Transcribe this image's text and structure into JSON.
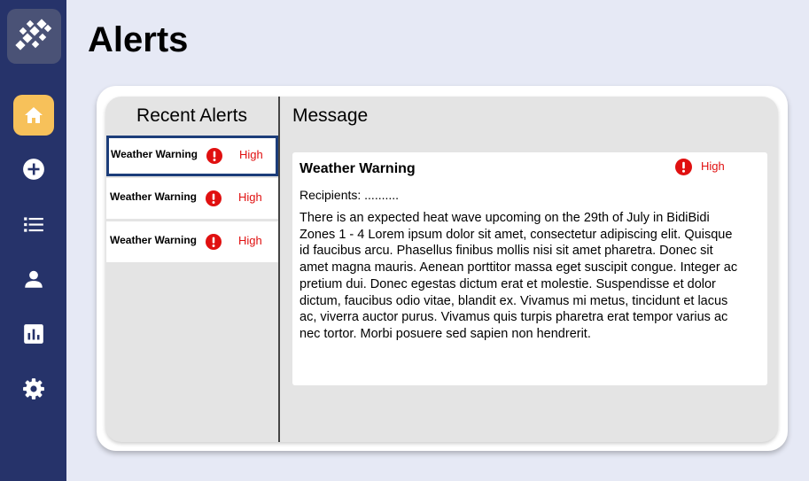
{
  "page": {
    "title": "Alerts"
  },
  "sidebar": {
    "nav": [
      {
        "icon": "home-icon",
        "active": true
      },
      {
        "icon": "add-circle-icon"
      },
      {
        "icon": "list-icon"
      },
      {
        "icon": "person-icon"
      },
      {
        "icon": "bar-chart-icon"
      },
      {
        "icon": "gear-icon"
      }
    ]
  },
  "recent_alerts": {
    "title": "Recent Alerts",
    "items": [
      {
        "name": "Weather Warning",
        "severity": "High",
        "selected": true
      },
      {
        "name": "Weather Warning",
        "severity": "High"
      },
      {
        "name": "Weather Warning",
        "severity": "High"
      }
    ]
  },
  "message": {
    "title": "Message",
    "alert_title": "Weather Warning",
    "severity": "High",
    "recipients": "Recipients: ..........",
    "body": "There is an expected heat wave upcoming on the 29th of July in BidiBidi Zones 1 - 4 Lorem ipsum dolor sit amet, consectetur adipiscing elit. Quisque id faucibus arcu. Phasellus finibus mollis nisi sit amet pharetra. Donec sit amet magna mauris. Aenean porttitor massa eget suscipit congue. Integer ac pretium dui. Donec egestas dictum erat et molestie. Suspendisse et dolor dictum, faucibus odio vitae, blandit ex. Vivamus mi metus, tincidunt et lacus ac, viverra auctor purus. Vivamus quis turpis pharetra erat tempor varius ac nec tortor. Morbi posuere sed sapien non hendrerit."
  },
  "colors": {
    "sidebar": "#26336a",
    "active_nav": "#f7c15a",
    "severity_high": "#e01010",
    "selected_border": "#1c3d7a"
  }
}
